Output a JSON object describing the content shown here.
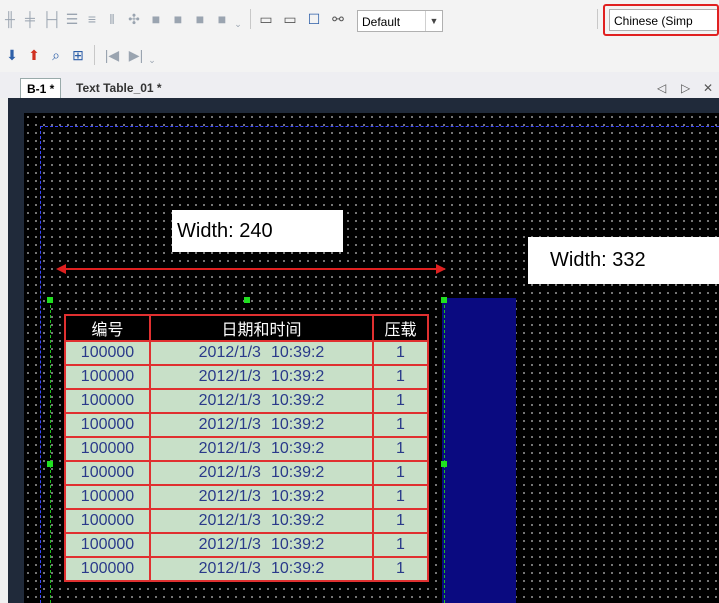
{
  "toolbar": {
    "style_select": "Default",
    "language_select": "Chinese (Simp"
  },
  "tabs": [
    {
      "label": "B-1 *"
    },
    {
      "label": "Text Table_01 *"
    }
  ],
  "tab_nav": {
    "prev": "◁",
    "next": "▷",
    "close": "✕"
  },
  "annotations": {
    "width_left": "Width: 240",
    "width_right": "Width: 332"
  },
  "table": {
    "headers": [
      "编号",
      "日期和时间",
      "压载"
    ],
    "rows": [
      {
        "id": "100000",
        "date": "2012/1/3",
        "time": "10:39:2",
        "value": "1"
      },
      {
        "id": "100000",
        "date": "2012/1/3",
        "time": "10:39:2",
        "value": "1"
      },
      {
        "id": "100000",
        "date": "2012/1/3",
        "time": "10:39:2",
        "value": "1"
      },
      {
        "id": "100000",
        "date": "2012/1/3",
        "time": "10:39:2",
        "value": "1"
      },
      {
        "id": "100000",
        "date": "2012/1/3",
        "time": "10:39:2",
        "value": "1"
      },
      {
        "id": "100000",
        "date": "2012/1/3",
        "time": "10:39:2",
        "value": "1"
      },
      {
        "id": "100000",
        "date": "2012/1/3",
        "time": "10:39:2",
        "value": "1"
      },
      {
        "id": "100000",
        "date": "2012/1/3",
        "time": "10:39:2",
        "value": "1"
      },
      {
        "id": "100000",
        "date": "2012/1/3",
        "time": "10:39:2",
        "value": "1"
      },
      {
        "id": "100000",
        "date": "2012/1/3",
        "time": "10:39:2",
        "value": "1"
      }
    ]
  },
  "colors": {
    "canvas_bg": "#000000",
    "table_cell_bg": "#c8e0c8",
    "table_border": "#e03030",
    "panel_navy": "#0a0a80",
    "highlight_red": "#e02020",
    "selection_green": "#20e020"
  }
}
